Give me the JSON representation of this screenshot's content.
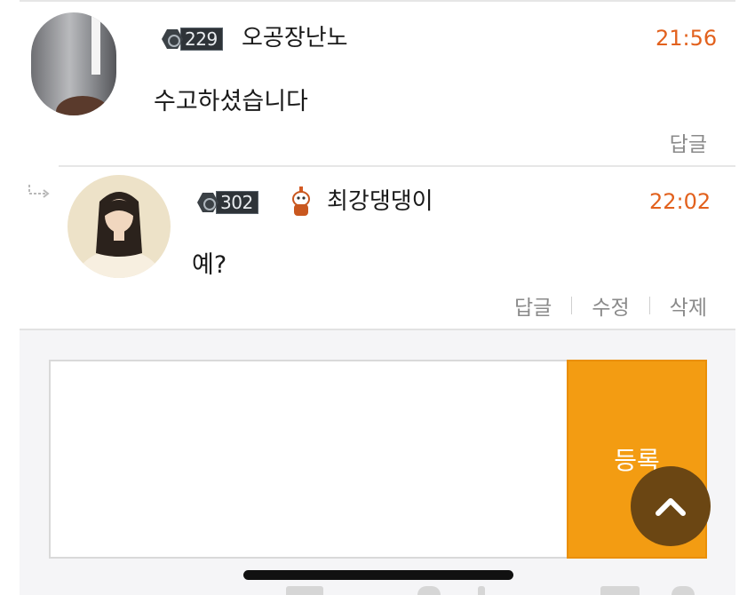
{
  "comments": [
    {
      "level": "229",
      "nickname": "오공장난노",
      "time": "21:56",
      "text": "수고하셨습니다",
      "actions": [
        "답글"
      ]
    },
    {
      "level": "302",
      "nickname": "최강댕댕이",
      "time": "22:02",
      "text": "예?",
      "actions": [
        "답글",
        "수정",
        "삭제"
      ]
    }
  ],
  "composer": {
    "placeholder": "",
    "submit_label": "등록"
  },
  "colors": {
    "accent": "#e2611d",
    "submit": "#f39c12",
    "scroll_top": "#6b4613"
  }
}
